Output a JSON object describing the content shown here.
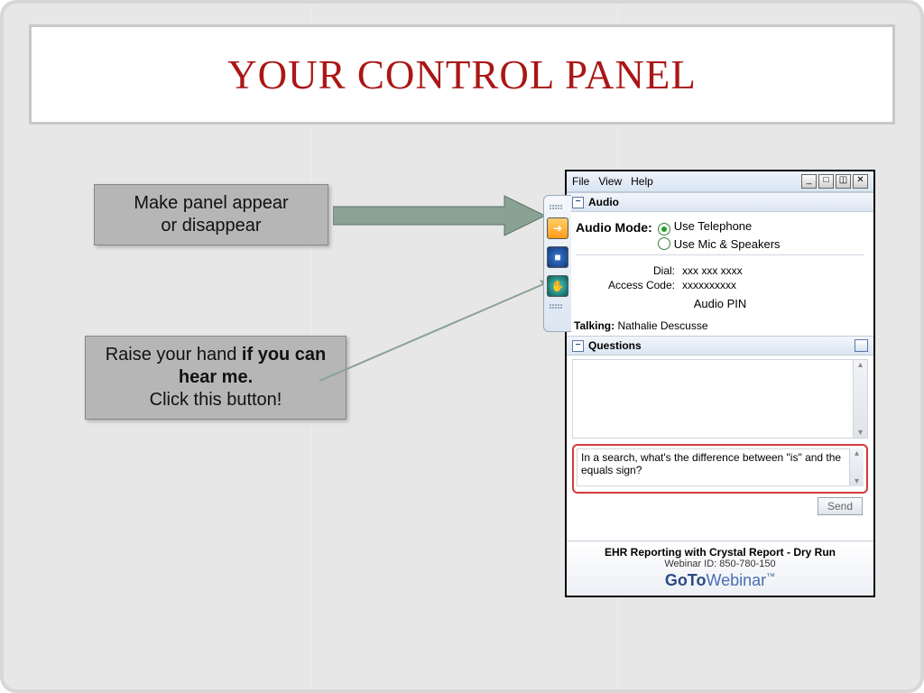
{
  "title": "YOUR CONTROL PANEL",
  "callouts": {
    "c1": {
      "line1": "Make panel appear",
      "line2": "or disappear"
    },
    "c2": {
      "line1": "Raise your hand ",
      "bold": "if you can hear me.",
      "line3": " Click this button!"
    }
  },
  "menu": {
    "file": "File",
    "view": "View",
    "help": "Help"
  },
  "window_buttons": {
    "min": "_",
    "max": "□",
    "rest": "◫",
    "close": "✕"
  },
  "audio": {
    "section_label": "Audio",
    "mode_label": "Audio Mode:",
    "telephone": "Use Telephone",
    "mic": "Use Mic & Speakers",
    "dial_label": "Dial:",
    "dial_value": "xxx xxx xxxx",
    "access_label": "Access Code:",
    "access_value": "xxxxxxxxxx",
    "pin_label": "Audio PIN"
  },
  "talking": {
    "label": "Talking:",
    "name": "Nathalie Descusse"
  },
  "questions": {
    "section_label": "Questions",
    "entry_text": "In a search, what's the difference between \"is\" and the equals sign?",
    "send_label": "Send"
  },
  "footer": {
    "session": "EHR Reporting with Crystal Report - Dry Run",
    "webinar_id_label": "Webinar ID: ",
    "webinar_id": "850-780-150",
    "brand_goto": "GoTo",
    "brand_web": "Webinar",
    "brand_tm": "™"
  },
  "icons": {
    "collapse": "−",
    "arrow_right": "➔",
    "square": "■",
    "hand": "✋",
    "scroll_up": "▴",
    "scroll_down": "▾"
  }
}
